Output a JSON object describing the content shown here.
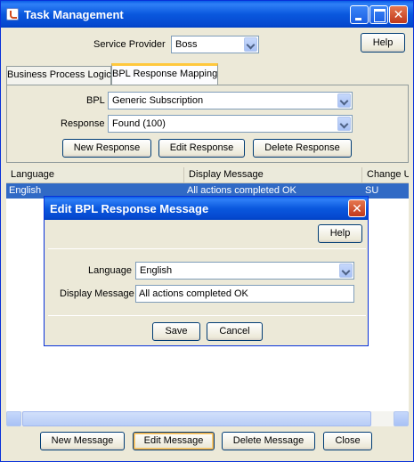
{
  "window": {
    "title": "Task Management"
  },
  "service_provider": {
    "label": "Service Provider",
    "value": "Boss"
  },
  "help_label": "Help",
  "tabs": [
    {
      "label": "Business Process Logic",
      "active": false
    },
    {
      "label": "BPL Response Mapping",
      "active": true
    }
  ],
  "mapping": {
    "bpl_label": "BPL",
    "bpl_value": "Generic Subscription",
    "response_label": "Response",
    "response_value": "Found (100)",
    "new_response": "New Response",
    "edit_response": "Edit Response",
    "delete_response": "Delete Response"
  },
  "table": {
    "columns": [
      "Language",
      "Display Message",
      "Change U"
    ],
    "rows": [
      {
        "language": "English",
        "display_message": "All actions completed OK",
        "change": "SU",
        "selected": true
      }
    ]
  },
  "bottom_buttons": {
    "new_message": "New Message",
    "edit_message": "Edit Message",
    "delete_message": "Delete Message",
    "close": "Close"
  },
  "dialog": {
    "title": "Edit BPL Response Message",
    "help": "Help",
    "language_label": "Language",
    "language_value": "English",
    "display_message_label": "Display Message",
    "display_message_value": "All actions completed OK",
    "save": "Save",
    "cancel": "Cancel"
  },
  "colors": {
    "titlebar": "#0a58de",
    "selection": "#316ac5",
    "focus_ring": "#f8cf75",
    "window_bg": "#ece9d8"
  },
  "icons": [
    "java-app-icon",
    "minimize-icon",
    "maximize-icon",
    "close-icon",
    "dropdown-arrow-icon",
    "scroll-left-icon",
    "scroll-right-icon"
  ]
}
